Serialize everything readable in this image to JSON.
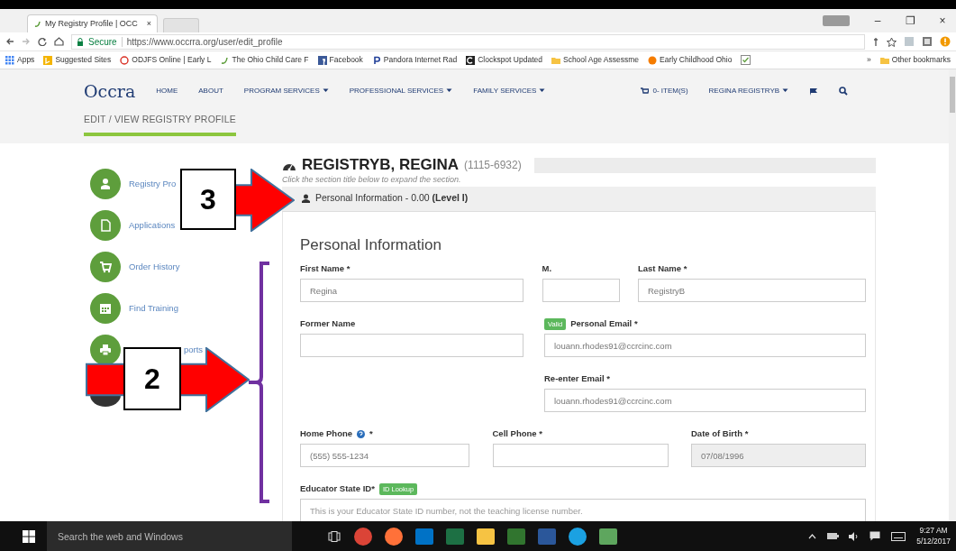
{
  "browser": {
    "tab_title": "My Registry Profile | OCC",
    "tab_close": "×",
    "window_controls": [
      "–",
      "❐",
      "×"
    ],
    "secure_label": "Secure",
    "url": "https://www.occrra.org/user/edit_profile",
    "bookmarks": [
      {
        "label": "Apps",
        "kind": "apps"
      },
      {
        "label": "Suggested Sites",
        "kind": "bing"
      },
      {
        "label": "ODJFS Online | Early L",
        "kind": "ring"
      },
      {
        "label": "The Ohio Child Care F",
        "kind": "swoosh"
      },
      {
        "label": "Facebook",
        "kind": "facebook"
      },
      {
        "label": "Pandora Internet Rad",
        "kind": "pandora"
      },
      {
        "label": "Clockspot Updated",
        "kind": "clock"
      },
      {
        "label": "School Age Assessme",
        "kind": "folder"
      },
      {
        "label": "Early Childhood Ohio",
        "kind": "dot"
      }
    ],
    "more": "»",
    "other_bookmarks": "Other bookmarks"
  },
  "site": {
    "logo": "Occra",
    "nav": [
      {
        "label": "HOME",
        "dropdown": false
      },
      {
        "label": "ABOUT",
        "dropdown": false
      },
      {
        "label": "PROGRAM SERVICES",
        "dropdown": true
      },
      {
        "label": "PROFESSIONAL SERVICES",
        "dropdown": true
      },
      {
        "label": "FAMILY SERVICES",
        "dropdown": true
      }
    ],
    "cart": "0- ITEM(S)",
    "user": "REGINA REGISTRYB",
    "subtitle": "EDIT / VIEW REGISTRY PROFILE"
  },
  "sidebar": {
    "items": [
      {
        "label": "Registry Pro",
        "kind": "user"
      },
      {
        "label": "Applications",
        "kind": "file"
      },
      {
        "label": "Order History",
        "kind": "cart"
      },
      {
        "label": "Find Training",
        "kind": "calendar"
      },
      {
        "label": "ports",
        "kind": "print"
      },
      {
        "kind": "exit"
      }
    ]
  },
  "profile": {
    "name": "REGISTRYB, REGINA",
    "id": "(1115-6932)",
    "hint": "Click the section title below to expand the section.",
    "section_title": "Personal Information - 0.00 **(Level I)**",
    "expanded": true,
    "heading": "Personal Information",
    "rows": [
      [
        {
          "label": "First Name *",
          "value": "Regina",
          "disabled": false
        },
        {
          "label": "M.",
          "disabled": false
        },
        {
          "label": "Last Name *",
          "value": "RegistryB",
          "disabled": false
        }
      ],
      [
        {
          "label": "Former Name",
          "disabled": false
        },
        {
          "label": "Personal Email *",
          "badge": "Valid",
          "value": "louann.rhodes91@ccrcinc.com",
          "disabled": false
        }
      ],
      [
        {
          "label": "Re-enter Email *",
          "value": "louann.rhodes91@ccrcinc.com",
          "disabled": false
        }
      ],
      [
        {
          "label": "Home Phone",
          "help": true,
          "mark": "*",
          "value": "(555) 555-1234",
          "disabled": false
        },
        {
          "label": "Cell Phone *",
          "disabled": false
        },
        {
          "label": "Date of Birth *",
          "value": "07/08/1996",
          "disabled": true
        }
      ],
      [
        {
          "label": "Educator State ID*",
          "badge": "ID Lookup",
          "placeholder": "This is your Educator State ID number, not the teaching license number.",
          "disabled": false
        }
      ]
    ]
  },
  "annotations": [
    {
      "kind": "arrow",
      "number": "3"
    },
    {
      "kind": "arrow",
      "number": "2"
    },
    {
      "kind": "bracket"
    }
  ],
  "taskbar": {
    "search_placeholder": "Search the web and Windows",
    "time": "9:27 AM",
    "date": "5/12/2017"
  }
}
